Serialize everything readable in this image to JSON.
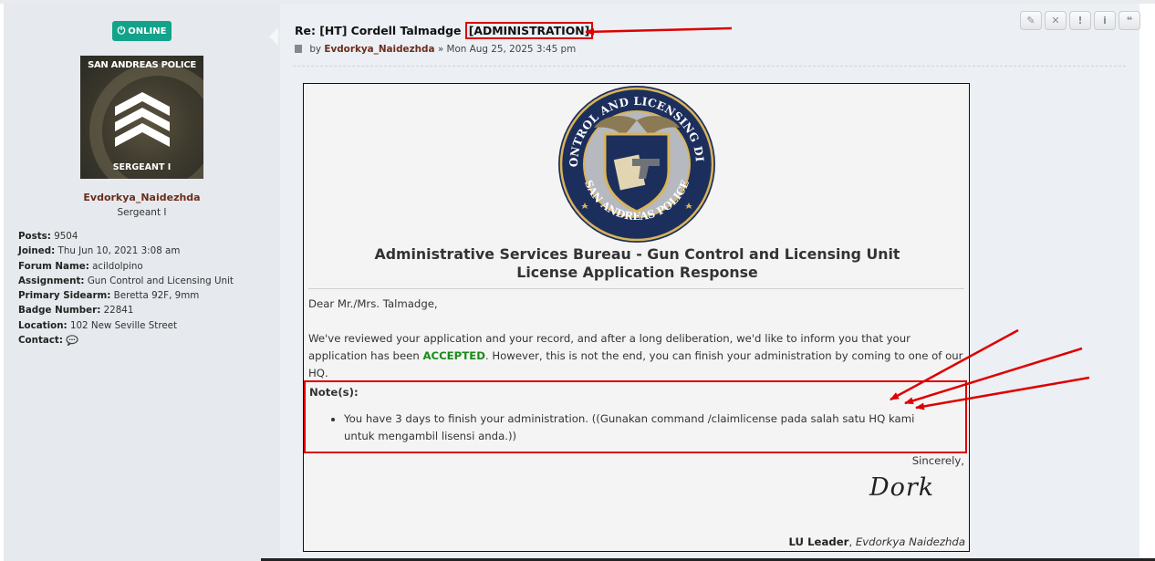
{
  "profile": {
    "online_label": "ONLINE",
    "avatar_top_text": "SAN ANDREAS POLICE",
    "avatar_bottom_text": "SERGEANT I",
    "username": "Evdorkya_Naidezhda",
    "rank": "Sergeant I",
    "fields": [
      {
        "label": "Posts:",
        "value": "9504"
      },
      {
        "label": "Joined:",
        "value": "Thu Jun 10, 2021 3:08 am"
      },
      {
        "label": "Forum Name:",
        "value": "acildolpino"
      },
      {
        "label": "Assignment:",
        "value": "Gun Control and Licensing Unit"
      },
      {
        "label": "Primary Sidearm:",
        "value": "Beretta 92F, 9mm"
      },
      {
        "label": "Badge Number:",
        "value": "22841"
      },
      {
        "label": "Location:",
        "value": "102 New Seville Street"
      },
      {
        "label": "Contact:",
        "value": ""
      }
    ]
  },
  "post": {
    "title_prefix": "Re: [HT] Cordell Talmadge",
    "title_tag": "[ADMINISTRATION]",
    "meta_by": "by",
    "meta_author": "Evdorkya_Naidezhda",
    "meta_date": "» Mon Aug 25, 2025 3:45 pm"
  },
  "toolbar": {
    "edit_icon": "✎",
    "delete_icon": "✕",
    "report_icon": "!",
    "info_icon": "i",
    "quote_icon": "❝"
  },
  "seal": {
    "top_text": "GUN CONTROL AND LICENSING DIVISION",
    "bottom_text": "SAN ANDREAS POLICE"
  },
  "document": {
    "title_line1": "Administrative Services Bureau - Gun Control and Licensing Unit",
    "title_line2": "License Application Response",
    "greeting": "Dear Mr./Mrs. Talmadge,",
    "body_before": "We've reviewed your application and your record, and after a long deliberation, we'd like to inform you that your application has been ",
    "body_status": "ACCEPTED",
    "body_after": ". However, this is not the end, you can finish your administration by coming to one of our HQ.",
    "note_heading": "Note(s):",
    "note_item": "You have 3 days to finish your administration. ((Gunakan command /claimlicense pada salah satu HQ kami untuk mengambil lisensi anda.))",
    "sincerely": "Sincerely,",
    "signature": "Dork",
    "closing_role": "LU Leader",
    "closing_name": "Evdorkya Naidezhda"
  },
  "colors": {
    "online_badge": "#12a38a",
    "username": "#6b2d1b",
    "accepted": "#1b8a1b",
    "annotation_red": "#dd0000"
  }
}
